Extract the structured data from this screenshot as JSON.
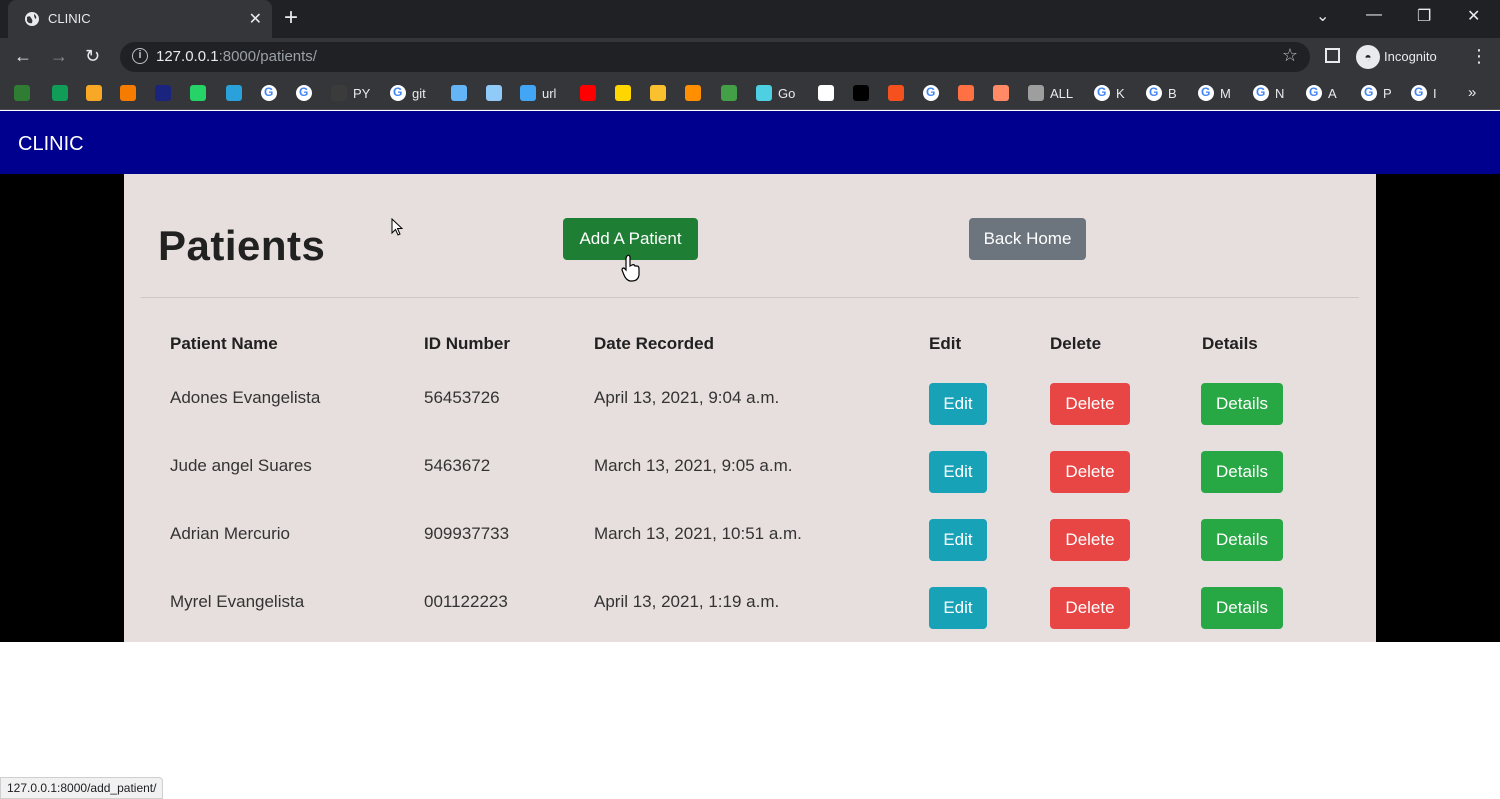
{
  "browser": {
    "tab_title": "CLINIC",
    "url_host": "127.0.0.1",
    "url_rest": ":8000/patients/",
    "profile_label": "Incognito",
    "bookmarks": [
      {
        "label": "",
        "color": "#2e7d32",
        "icon": "bookmark-icon"
      },
      {
        "label": "",
        "color": "#0f9d58",
        "icon": "sheets-icon"
      },
      {
        "label": "",
        "color": "#f9a825",
        "icon": "app-icon"
      },
      {
        "label": "",
        "color": "#f57c00",
        "icon": "analytics-icon"
      },
      {
        "label": "",
        "color": "#1a237e",
        "icon": "ieee-icon"
      },
      {
        "label": "",
        "color": "#25d366",
        "icon": "whatsapp-icon"
      },
      {
        "label": "",
        "color": "#2aa1da",
        "icon": "telegram-icon"
      },
      {
        "label": "",
        "color": "g",
        "icon": "google-icon"
      },
      {
        "label": "",
        "color": "g",
        "icon": "google-icon"
      },
      {
        "label": "PY",
        "color": "#3b3b3b",
        "icon": "github-icon"
      },
      {
        "label": "git",
        "color": "g",
        "icon": "google-icon"
      },
      {
        "label": "",
        "color": "#64b5f6",
        "icon": "image-icon"
      },
      {
        "label": "",
        "color": "#90caf9",
        "icon": "car-icon"
      },
      {
        "label": "url",
        "color": "#42a5f5",
        "icon": "wifi-icon"
      },
      {
        "label": "",
        "color": "#ff0000",
        "icon": "youtube-icon"
      },
      {
        "label": "",
        "color": "#ffd600",
        "icon": "p-icon"
      },
      {
        "label": "",
        "color": "#fbc02d",
        "icon": "camera-icon"
      },
      {
        "label": "",
        "color": "#ff8f00",
        "icon": "bookmark-icon"
      },
      {
        "label": "",
        "color": "#43a047",
        "icon": "circle-icon"
      },
      {
        "label": "Go",
        "color": "#4dd0e1",
        "icon": "go-icon"
      },
      {
        "label": "",
        "color": "#ffffff",
        "icon": "doc-icon"
      },
      {
        "label": "",
        "color": "#000000",
        "icon": "cl-icon"
      },
      {
        "label": "",
        "color": "#f4511e",
        "icon": "yandex-icon"
      },
      {
        "label": "",
        "color": "g",
        "icon": "google-icon"
      },
      {
        "label": "",
        "color": "#ff7043",
        "icon": "bookmark-icon"
      },
      {
        "label": "",
        "color": "#ff8a65",
        "icon": "eye-icon"
      },
      {
        "label": "ALL",
        "color": "#9e9e9e",
        "icon": "globe-icon"
      },
      {
        "label": "K",
        "color": "g",
        "icon": "google-icon"
      },
      {
        "label": "B",
        "color": "g",
        "icon": "google-icon"
      },
      {
        "label": "M",
        "color": "g",
        "icon": "google-icon"
      },
      {
        "label": "N",
        "color": "g",
        "icon": "google-icon"
      },
      {
        "label": "A",
        "color": "g",
        "icon": "google-icon"
      },
      {
        "label": "P",
        "color": "g",
        "icon": "google-icon"
      },
      {
        "label": "I",
        "color": "g",
        "icon": "google-icon"
      }
    ]
  },
  "navbar": {
    "brand": "CLINIC"
  },
  "page": {
    "title": "Patients",
    "add_button": "Add A Patient",
    "home_button": "Back Home"
  },
  "table": {
    "headers": [
      "Patient Name",
      "ID Number",
      "Date Recorded",
      "Edit",
      "Delete",
      "Details"
    ],
    "rows": [
      {
        "name": "Adones Evangelista",
        "id": "56453726",
        "date": "April 13, 2021, 9:04 a.m.",
        "edit": "Edit",
        "delete": "Delete",
        "details": "Details"
      },
      {
        "name": "Jude angel Suares",
        "id": "5463672",
        "date": "March 13, 2021, 9:05 a.m.",
        "edit": "Edit",
        "delete": "Delete",
        "details": "Details"
      },
      {
        "name": "Adrian Mercurio",
        "id": "909937733",
        "date": "March 13, 2021, 10:51 a.m.",
        "edit": "Edit",
        "delete": "Delete",
        "details": "Details"
      },
      {
        "name": "Myrel Evangelista",
        "id": "001122223",
        "date": "April 13, 2021, 1:19 a.m.",
        "edit": "Edit",
        "delete": "Delete",
        "details": "Details"
      }
    ]
  },
  "status_bar": "127.0.0.1:8000/add_patient/"
}
